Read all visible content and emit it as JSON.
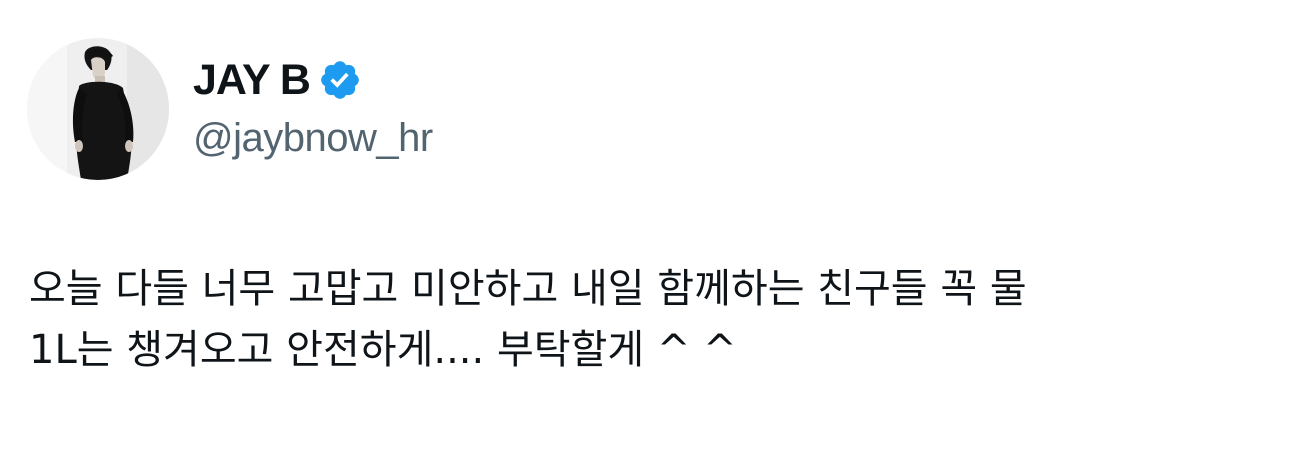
{
  "author": {
    "display_name": "JAY B",
    "handle": "@jaybnow_hr",
    "verified": true,
    "verified_color": "#1d9bf0"
  },
  "tweet": {
    "text_lines": [
      "오늘 다들 너무 고맙고 미안하고 내일 함께하는 친구들 꼭 물",
      "1L는 챙겨오고 안전하게.... 부탁할게 ^ ^"
    ]
  },
  "icons": {
    "verified_badge": "verified-check-icon"
  }
}
